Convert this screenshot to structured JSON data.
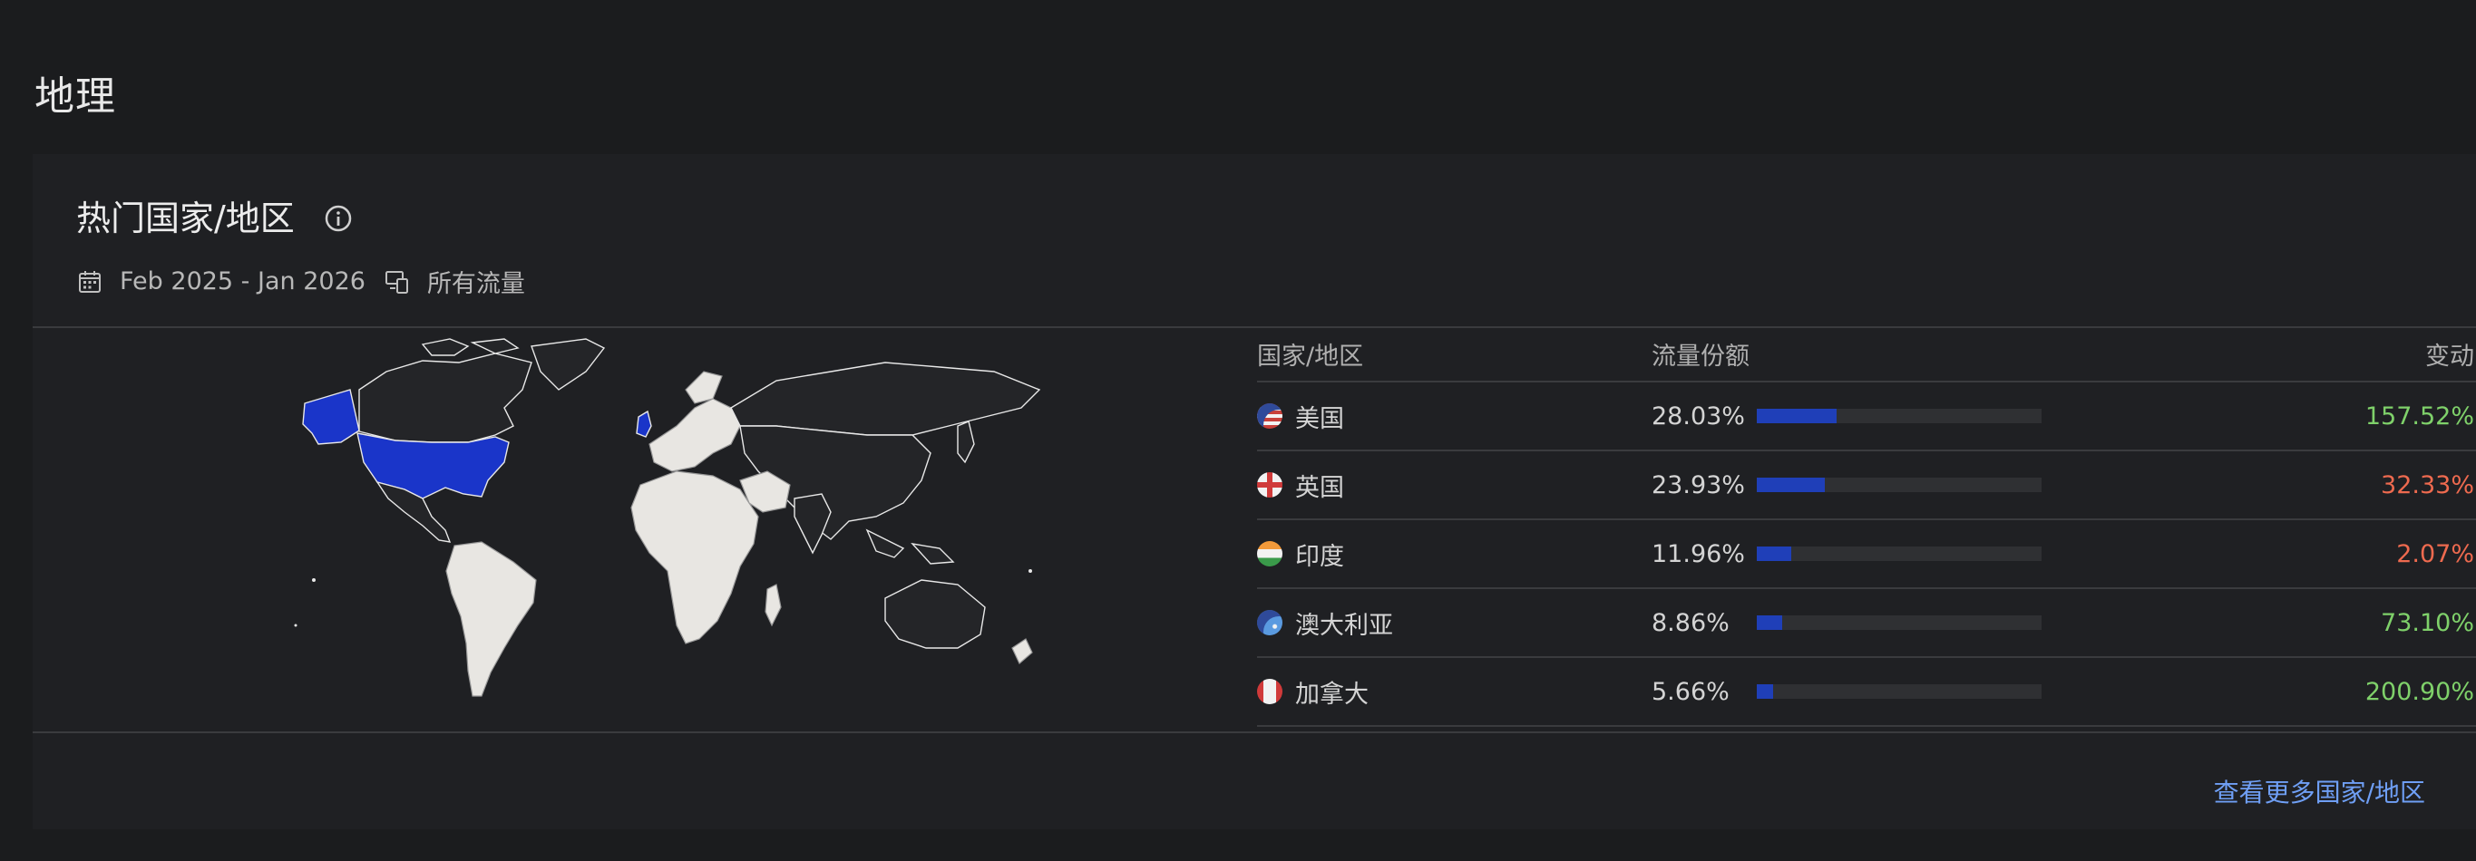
{
  "section": {
    "title": "地理"
  },
  "card": {
    "title": "热门国家/地区",
    "date_range": "Feb 2025 - Jan 2026",
    "traffic_filter": "所有流量",
    "footer_link": "查看更多国家/地区"
  },
  "table": {
    "headers": {
      "country": "国家/地区",
      "share": "流量份额",
      "change": "变动"
    },
    "rows": [
      {
        "country": "美国",
        "share": "28.03%",
        "share_value": 28.03,
        "change": "157.52%",
        "change_positive": true
      },
      {
        "country": "英国",
        "share": "23.93%",
        "share_value": 23.93,
        "change": "32.33%",
        "change_positive": false
      },
      {
        "country": "印度",
        "share": "11.96%",
        "share_value": 11.96,
        "change": "2.07%",
        "change_positive": false
      },
      {
        "country": "澳大利亚",
        "share": "8.86%",
        "share_value": 8.86,
        "change": "73.10%",
        "change_positive": true
      },
      {
        "country": "加拿大",
        "share": "5.66%",
        "share_value": 5.66,
        "change": "200.90%",
        "change_positive": true
      }
    ]
  },
  "colors": {
    "accent": "#1f3fb8",
    "positive": "#7fd16a",
    "negative": "#ee6a4f",
    "link": "#6f9ff5",
    "background": "#1b1c1e",
    "card": "#1f2023"
  },
  "icons": {
    "info": "info-icon",
    "calendar": "calendar-icon",
    "devices": "devices-icon"
  }
}
